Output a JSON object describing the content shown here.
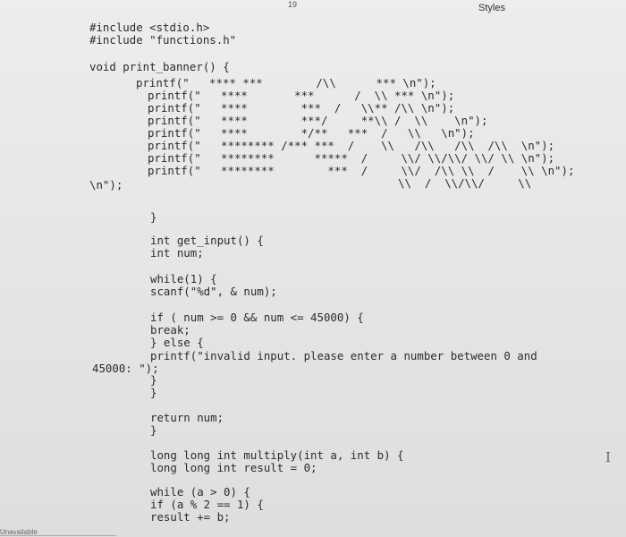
{
  "header": {
    "marker": "19",
    "styles_label": "Styles"
  },
  "code": {
    "inc1": "#include <stdio.h>",
    "inc2": "#include \"functions.h\"",
    "func_banner": "void print_banner() {",
    "p1": "printf(\"   **** ***        /\\\\      *** \\n\");",
    "p2": "printf(\"   ****       ***      /  \\\\ *** \\n\");",
    "p3": "printf(\"   ****        ***  /   \\\\** /\\\\ \\n\");",
    "p4": "printf(\"   ****        ***/     **\\\\ /  \\\\    \\n\");",
    "p5": "printf(\"   ****        */**   ***  /   \\\\   \\n\");",
    "p6": "printf(\"   ******** /*** ***  /    \\\\   /\\\\   /\\\\  /\\\\  \\n\");",
    "p7": "printf(\"   ********      *****  /     \\\\/ \\\\/\\\\/ \\\\/ \\\\ \\n\");",
    "p8": "printf(\"   ********        ***  /     \\\\/  /\\\\ \\\\  /    \\\\ \\n\");",
    "p8b": "\\\\  /  \\\\/\\\\/     \\\\",
    "nl_close": "\\n\");",
    "close1": "}",
    "get_input": "int get_input() {",
    "num_decl": "int num;",
    "while1": "while(1) {",
    "scanf": "scanf(\"%d\", & num);",
    "if_cond": "if ( num >= 0 && num <= 45000) {",
    "brk": "break;",
    "else": "} else {",
    "printf_invalid": "printf(\"invalid input. please enter a number between 0 and",
    "cont_45000": "45000: \");",
    "close2": "}",
    "close3": "}",
    "ret": "return num;",
    "close4": "}",
    "multiply": "long long int multiply(int a, int b) {",
    "result_decl": "long long int result = 0;",
    "while2": "while (a > 0) {",
    "if2": "if (a % 2 == 1) {",
    "result_add": "result += b;"
  },
  "footer": {
    "status": "Unavailable"
  },
  "icons": {
    "cursor": "text-cursor-icon"
  }
}
